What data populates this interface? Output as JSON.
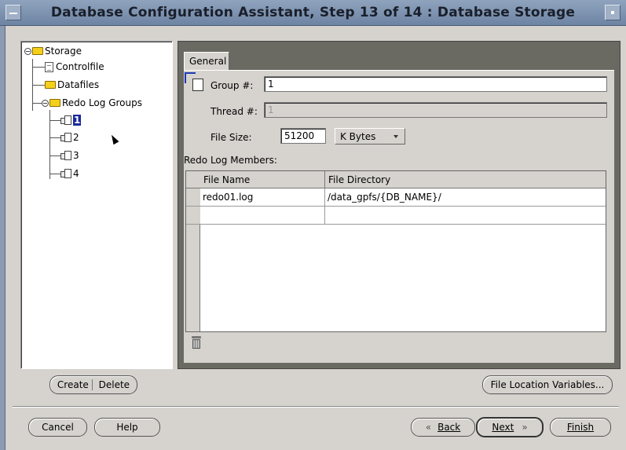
{
  "window": {
    "title": "Database Configuration Assistant, Step 13 of 14 : Database Storage"
  },
  "tree": {
    "root": "Storage",
    "controlfile": "Controlfile",
    "datafiles": "Datafiles",
    "redo_groups": "Redo Log Groups",
    "groups": [
      "1",
      "2",
      "3",
      "4"
    ],
    "selected_group": "1"
  },
  "tab": {
    "label": "General"
  },
  "form": {
    "group_label": "Group #:",
    "group_value": "1",
    "thread_label": "Thread #:",
    "thread_value": "1",
    "filesize_label": "File Size:",
    "filesize_value": "51200",
    "unit_value": "K Bytes",
    "members_label": "Redo Log Members:"
  },
  "members_table": {
    "columns": [
      "File Name",
      "File Directory"
    ],
    "rows": [
      [
        "redo01.log",
        "/data_gpfs/{DB_NAME}/"
      ],
      [
        "",
        ""
      ]
    ]
  },
  "buttons": {
    "create": "Create",
    "delete": "Delete",
    "file_location_variables": "File Location Variables...",
    "cancel": "Cancel",
    "help": "Help",
    "back": "Back",
    "next": "Next",
    "finish": "Finish"
  },
  "icons": {
    "back": "«",
    "next": "»"
  }
}
